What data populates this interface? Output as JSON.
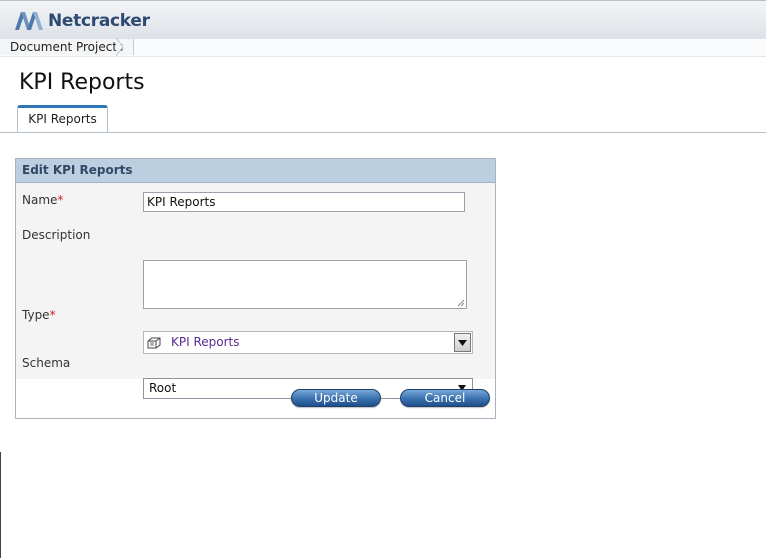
{
  "header": {
    "brand": "Netcracker"
  },
  "breadcrumb": {
    "items": [
      "Document Projects"
    ]
  },
  "page": {
    "title": "KPI Reports"
  },
  "tabs": [
    {
      "label": "KPI Reports",
      "active": true
    }
  ],
  "form": {
    "title": "Edit KPI Reports",
    "name": {
      "label": "Name",
      "required_mark": "*",
      "value": "KPI Reports"
    },
    "description": {
      "label": "Description",
      "value": ""
    },
    "type": {
      "label": "Type",
      "required_mark": "*",
      "value": "KPI Reports",
      "icon": "object-type-icon"
    },
    "schema": {
      "label": "Schema",
      "value": "Root"
    },
    "buttons": {
      "update": "Update",
      "cancel": "Cancel"
    }
  },
  "colors": {
    "accent": "#2f76b7",
    "panel_header": "#bccfe1",
    "required": "#d01f1f",
    "type_value": "#5a2b8e"
  }
}
